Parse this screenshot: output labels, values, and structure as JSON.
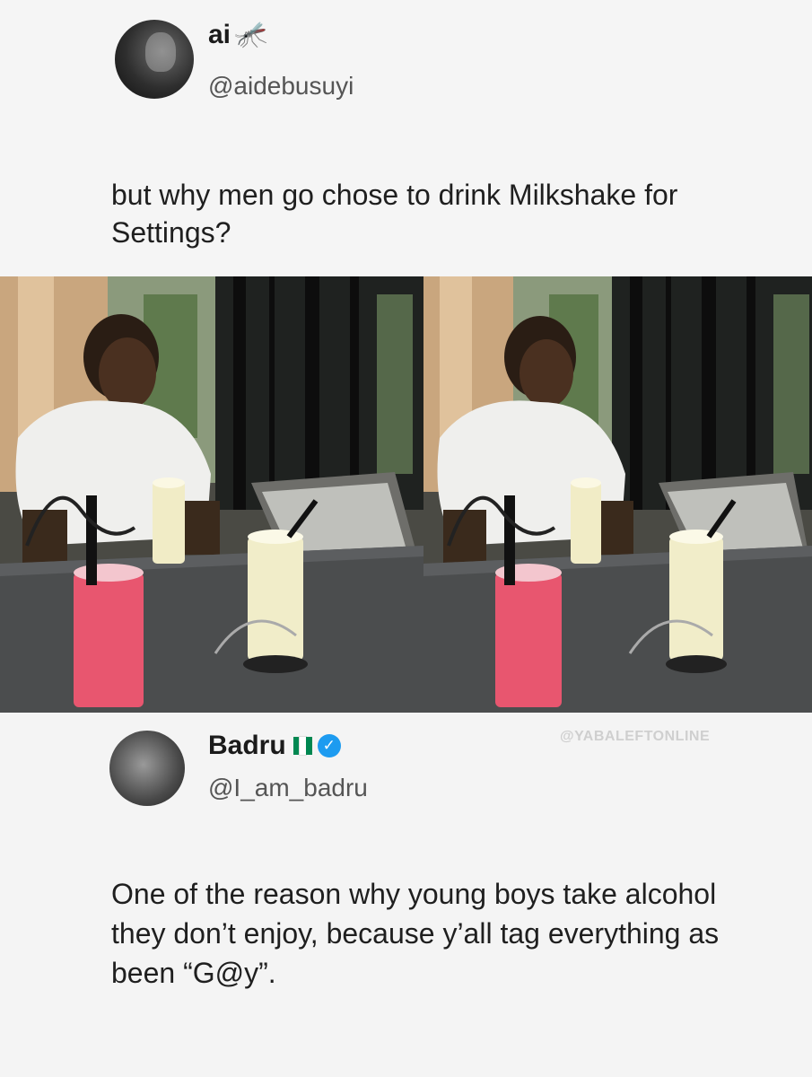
{
  "top_tweet": {
    "name": "ai",
    "name_emoji": "🦟",
    "handle": "@aidebusuyi",
    "text": "but why men go chose to drink Milkshake for Settings?"
  },
  "image": {
    "description_icon": "photo-icon",
    "panels": 2
  },
  "bottom_tweet": {
    "name": "Badru",
    "flag_colors": [
      "#008751",
      "#ffffff",
      "#008751"
    ],
    "verified_symbol": "✓",
    "handle": "@I_am_badru",
    "watermark": "@YABALEFTONLINE",
    "text": "One of the reason why young boys take alcohol they don’t enjoy, because y’all tag everything as been “G@y”."
  },
  "colors": {
    "verified_blue": "#1d9bf0",
    "pink_drink": "#e8566f",
    "milkshake": "#f1edc9"
  }
}
